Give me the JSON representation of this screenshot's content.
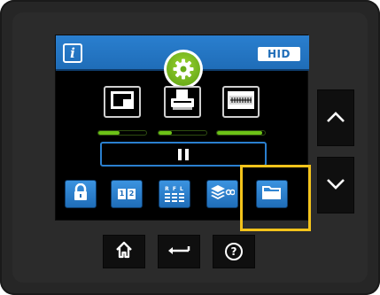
{
  "brand": {
    "logo_text": "HID"
  },
  "header": {
    "info_label": "i"
  },
  "status": {
    "tiles": [
      {
        "name": "card-supply-icon",
        "level": 0.45
      },
      {
        "name": "printer-icon",
        "level": 0.28
      },
      {
        "name": "ribbon-icon",
        "level": 0.95
      }
    ]
  },
  "controls": {
    "pause_icon": "pause-icon"
  },
  "function_buttons": [
    {
      "icon": "lock-icon"
    },
    {
      "icon": "two-panel-icon",
      "text_left": "1",
      "text_right": "2"
    },
    {
      "icon": "ribbon-panels-icon",
      "letters": "R F L"
    },
    {
      "icon": "layers-icon"
    },
    {
      "icon": "folder-icon"
    }
  ],
  "hardware_buttons": {
    "side": [
      "chevron-up-icon",
      "chevron-down-icon"
    ],
    "bottom": [
      "home-icon",
      "back-arrow-icon",
      "help-icon"
    ],
    "help_glyph": "?"
  },
  "colors": {
    "accent_blue": "#1f6db8",
    "status_green": "#6cc217",
    "settings_green": "#7cbf1f",
    "highlight_yellow": "#f3c31b"
  }
}
